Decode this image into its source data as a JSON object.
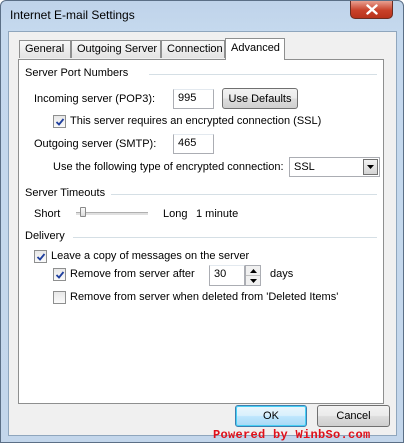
{
  "window": {
    "title": "Internet E-mail Settings"
  },
  "tabs": [
    {
      "label": "General"
    },
    {
      "label": "Outgoing Server"
    },
    {
      "label": "Connection"
    },
    {
      "label": "Advanced",
      "selected": true
    }
  ],
  "server_ports": {
    "group_label": "Server Port Numbers",
    "incoming_label": "Incoming server (POP3):",
    "incoming_value": "995",
    "use_defaults_label": "Use Defaults",
    "ssl_checkbox_label": "This server requires an encrypted connection (SSL)",
    "ssl_checked": true,
    "outgoing_label": "Outgoing server (SMTP):",
    "outgoing_value": "465",
    "encryption_label": "Use the following type of encrypted connection:",
    "encryption_value": "SSL"
  },
  "timeouts": {
    "group_label": "Server Timeouts",
    "short_label": "Short",
    "long_label": "Long",
    "value_label": "1 minute",
    "slider_level": 0.1
  },
  "delivery": {
    "group_label": "Delivery",
    "leave_copy_label": "Leave a copy of messages on the server",
    "leave_copy_checked": true,
    "remove_after_label": "Remove from server after",
    "remove_after_checked": true,
    "remove_after_days": "30",
    "days_label": "days",
    "remove_deleted_label": "Remove from server when deleted from 'Deleted Items'",
    "remove_deleted_checked": false
  },
  "footer": {
    "ok_label": "OK",
    "cancel_label": "Cancel"
  },
  "watermark": {
    "text": "Powered by WinbSo.com"
  },
  "colors": {
    "accent_blue": "#3c7fb1",
    "close_red": "#c8412a",
    "watermark_red": "#e0101a"
  }
}
